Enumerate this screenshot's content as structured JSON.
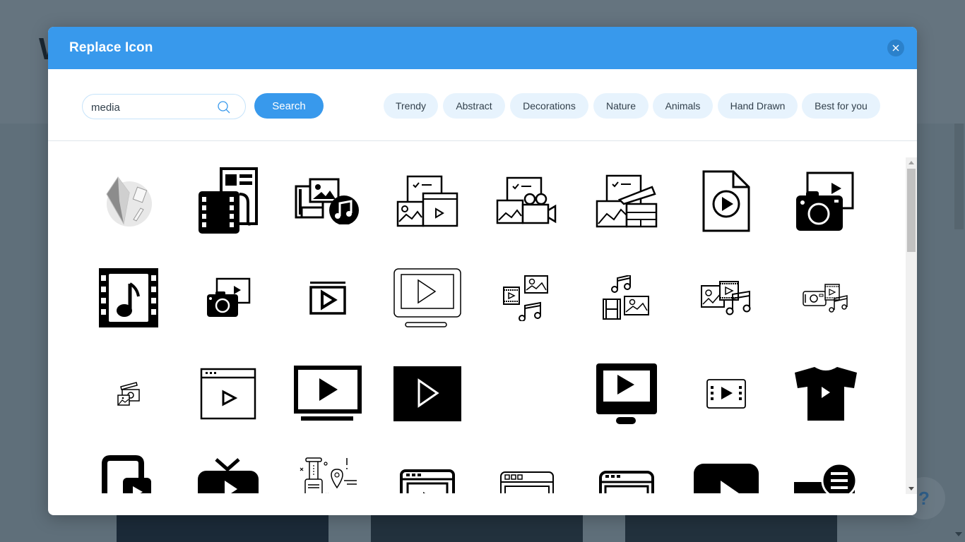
{
  "background": {
    "heading_fragment": "W",
    "help_label": "?"
  },
  "modal": {
    "title": "Replace Icon",
    "close_icon": "close-icon",
    "search": {
      "value": "media",
      "placeholder": "",
      "icon": "search-icon",
      "button_label": "Search"
    },
    "categories": [
      {
        "label": "Trendy"
      },
      {
        "label": "Abstract"
      },
      {
        "label": "Decorations"
      },
      {
        "label": "Nature"
      },
      {
        "label": "Animals"
      },
      {
        "label": "Hand Drawn"
      },
      {
        "label": "Best for you"
      }
    ],
    "colors": {
      "accent": "#3899ec",
      "close_bg": "#2b81cb",
      "chip_bg": "#e7f3fd",
      "text": "#32404c"
    },
    "icons": [
      {
        "name": "abstract-shapes-icon"
      },
      {
        "name": "film-newspaper-icon"
      },
      {
        "name": "film-image-music-icon"
      },
      {
        "name": "checklist-image-video-icon"
      },
      {
        "name": "checklist-image-camera-icon"
      },
      {
        "name": "checklist-image-clapper-icon"
      },
      {
        "name": "video-file-icon"
      },
      {
        "name": "camera-video-icon"
      },
      {
        "name": "film-music-icon"
      },
      {
        "name": "camera-slide-icon"
      },
      {
        "name": "video-player-icon"
      },
      {
        "name": "monitor-play-icon"
      },
      {
        "name": "video-image-music-icon"
      },
      {
        "name": "music-film-image-icon"
      },
      {
        "name": "image-film-music-icon"
      },
      {
        "name": "camera-film-music-icon"
      },
      {
        "name": "clapper-image-small-icon"
      },
      {
        "name": "browser-play-icon"
      },
      {
        "name": "tv-play-icon"
      },
      {
        "name": "play-square-icon"
      },
      {
        "name": "empty-icon"
      },
      {
        "name": "monitor-play-filled-icon"
      },
      {
        "name": "filmstrip-play-icon"
      },
      {
        "name": "tshirt-play-icon"
      },
      {
        "name": "device-play-icon"
      },
      {
        "name": "tv-antenna-icon"
      },
      {
        "name": "luggage-location-icon"
      },
      {
        "name": "browser-video-icon"
      },
      {
        "name": "browser-video-outline-icon"
      },
      {
        "name": "browser-video-bold-icon"
      },
      {
        "name": "play-rounded-icon"
      },
      {
        "name": "media-chat-icon"
      }
    ]
  }
}
